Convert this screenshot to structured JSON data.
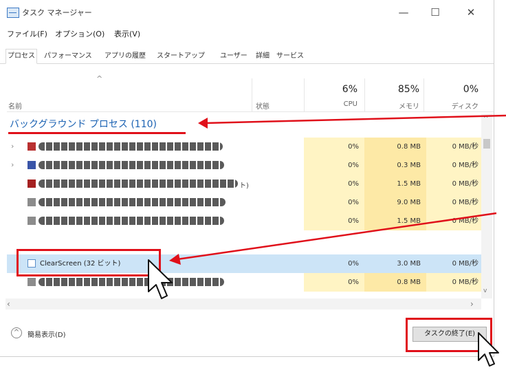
{
  "window": {
    "title": "タスク マネージャー"
  },
  "controls": {
    "minimize": "—",
    "maximize": "☐",
    "close": "✕"
  },
  "menu": [
    "ファイル(F)",
    "オプション(O)",
    "表示(V)"
  ],
  "tabs": [
    "プロセス",
    "パフォーマンス",
    "アプリの履歴",
    "スタートアップ",
    "ユーザー",
    "詳細",
    "サービス"
  ],
  "columns": {
    "name": "名前",
    "status": "状態",
    "cpu": {
      "pct": "6%",
      "label": "CPU"
    },
    "memory": {
      "pct": "85%",
      "label": "メモリ"
    },
    "disk": {
      "pct": "0%",
      "label": "ディスク"
    }
  },
  "group": {
    "label": "バックグラウンド プロセス (110)"
  },
  "rows": [
    {
      "name": "",
      "cpu": "0%",
      "memory": "0.8 MB",
      "disk": "0 MB/秒",
      "expand": "›"
    },
    {
      "name": "",
      "cpu": "0%",
      "memory": "0.3 MB",
      "disk": "0 MB/秒",
      "expand": "›"
    },
    {
      "name": "",
      "cpu": "0%",
      "memory": "1.5 MB",
      "disk": "0 MB/秒",
      "tail": "ト)"
    },
    {
      "name": "",
      "cpu": "0%",
      "memory": "9.0 MB",
      "disk": "0 MB/秒"
    },
    {
      "name": "",
      "cpu": "0%",
      "memory": "1.5 MB",
      "disk": "0 MB/秒"
    },
    {
      "name": "ClearScreen (32 ビット)",
      "cpu": "0%",
      "memory": "3.0 MB",
      "disk": "0 MB/秒",
      "selected": true
    },
    {
      "name": "",
      "cpu": "0%",
      "memory": "0.8 MB",
      "disk": "0 MB/秒"
    }
  ],
  "footer": {
    "fewer_details": "簡易表示(D)",
    "end_task": "タスクの終了(E)"
  },
  "colors": {
    "annotation": "#e0101a",
    "group_text": "#1b62b3",
    "selected_row": "#cce4f7"
  }
}
